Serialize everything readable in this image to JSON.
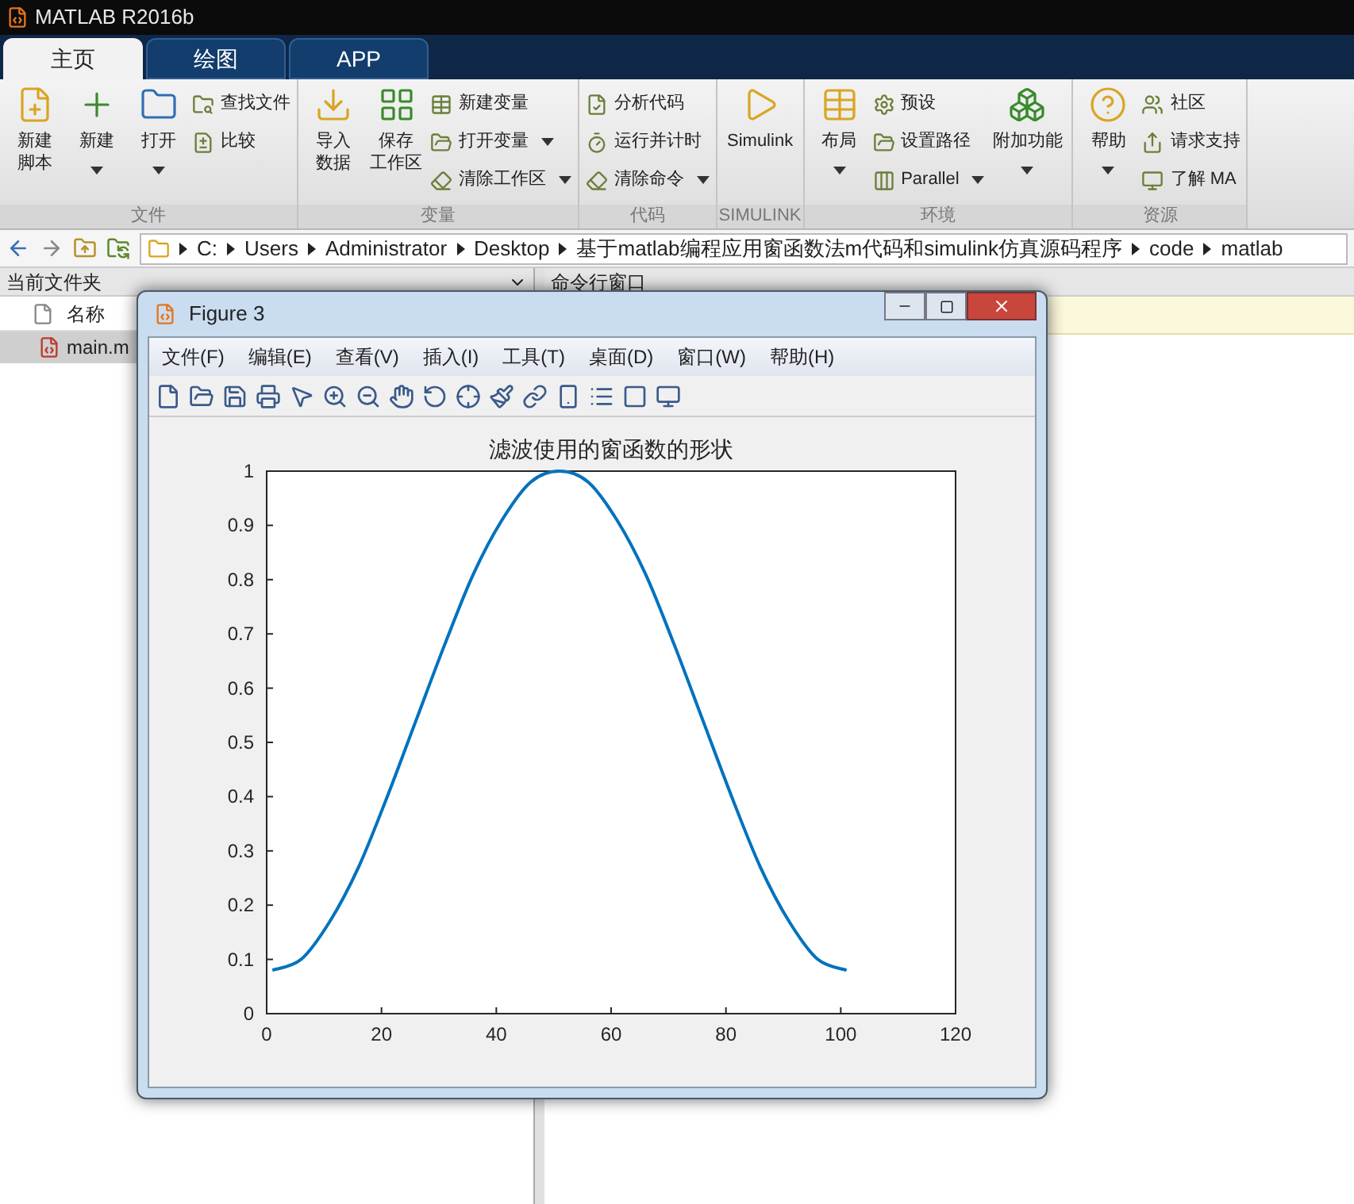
{
  "window": {
    "title": "MATLAB R2016b"
  },
  "tabs": [
    {
      "label": "主页",
      "selected": true
    },
    {
      "label": "绘图",
      "selected": false
    },
    {
      "label": "APP",
      "selected": false
    }
  ],
  "ribbon": [
    {
      "label": "文件",
      "items": [
        {
          "kind": "large",
          "lines": [
            "新建",
            "脚本"
          ],
          "dropdown": false
        },
        {
          "kind": "large",
          "lines": [
            "新建"
          ],
          "dropdown": true
        },
        {
          "kind": "large",
          "lines": [
            "打开"
          ],
          "dropdown": true
        },
        {
          "kind": "stack",
          "items": [
            {
              "label": "查找文件",
              "dropdown": false
            },
            {
              "label": "比较",
              "dropdown": false
            }
          ]
        }
      ]
    },
    {
      "label": "变量",
      "items": [
        {
          "kind": "large",
          "lines": [
            "导入",
            "数据"
          ],
          "dropdown": false
        },
        {
          "kind": "large",
          "lines": [
            "保存",
            "工作区"
          ],
          "dropdown": false
        },
        {
          "kind": "stack",
          "items": [
            {
              "label": "新建变量",
              "dropdown": false
            },
            {
              "label": "打开变量",
              "dropdown": true
            },
            {
              "label": "清除工作区",
              "dropdown": true
            }
          ]
        }
      ]
    },
    {
      "label": "代码",
      "items": [
        {
          "kind": "stack",
          "items": [
            {
              "label": "分析代码",
              "dropdown": false
            },
            {
              "label": "运行并计时",
              "dropdown": false
            },
            {
              "label": "清除命令",
              "dropdown": true
            }
          ]
        }
      ]
    },
    {
      "label": "SIMULINK",
      "items": [
        {
          "kind": "large",
          "lines": [
            "Simulink"
          ],
          "dropdown": false
        }
      ]
    },
    {
      "label": "环境",
      "items": [
        {
          "kind": "large",
          "lines": [
            "布局"
          ],
          "dropdown": true
        },
        {
          "kind": "stack",
          "items": [
            {
              "label": "预设",
              "dropdown": false
            },
            {
              "label": "设置路径",
              "dropdown": false
            },
            {
              "label": "Parallel",
              "dropdown": true
            }
          ]
        },
        {
          "kind": "large",
          "lines": [
            "附加功能"
          ],
          "dropdown": true
        }
      ]
    },
    {
      "label": "资源",
      "items": [
        {
          "kind": "large",
          "lines": [
            "帮助"
          ],
          "dropdown": true
        },
        {
          "kind": "stack",
          "items": [
            {
              "label": "社区",
              "dropdown": false
            },
            {
              "label": "请求支持",
              "dropdown": false
            },
            {
              "label": "了解 MA",
              "dropdown": false
            }
          ]
        }
      ]
    }
  ],
  "path": [
    "C:",
    "Users",
    "Administrator",
    "Desktop",
    "基于matlab编程应用窗函数法m代码和simulink仿真源码程序",
    "code",
    "matlab"
  ],
  "file_panel": {
    "title": "当前文件夹",
    "column": "名称",
    "files": [
      {
        "name": "main.m",
        "selected": true
      }
    ]
  },
  "command_panel": {
    "title": "命令行窗口"
  },
  "figure": {
    "title": "Figure 3",
    "menu": [
      "文件(F)",
      "编辑(E)",
      "查看(V)",
      "插入(I)",
      "工具(T)",
      "桌面(D)",
      "窗口(W)",
      "帮助(H)"
    ],
    "chart_data": {
      "type": "line",
      "title": "滤波使用的窗函数的形状",
      "x": [
        1,
        6,
        11,
        16,
        21,
        26,
        31,
        36,
        41,
        46,
        51,
        56,
        61,
        66,
        71,
        76,
        81,
        86,
        91,
        96,
        101
      ],
      "series": [
        {
          "color": "#0072bd",
          "values": [
            0.08,
            0.1,
            0.17,
            0.27,
            0.4,
            0.54,
            0.68,
            0.81,
            0.91,
            0.98,
            1.0,
            0.98,
            0.91,
            0.81,
            0.68,
            0.54,
            0.4,
            0.27,
            0.17,
            0.1,
            0.08
          ]
        }
      ],
      "xlim": [
        0,
        120
      ],
      "ylim": [
        0,
        1
      ],
      "xticks": [
        0,
        20,
        40,
        60,
        80,
        100,
        120
      ],
      "yticks": [
        0,
        0.1,
        0.2,
        0.3,
        0.4,
        0.5,
        0.6,
        0.7,
        0.8,
        0.9,
        1
      ]
    }
  }
}
